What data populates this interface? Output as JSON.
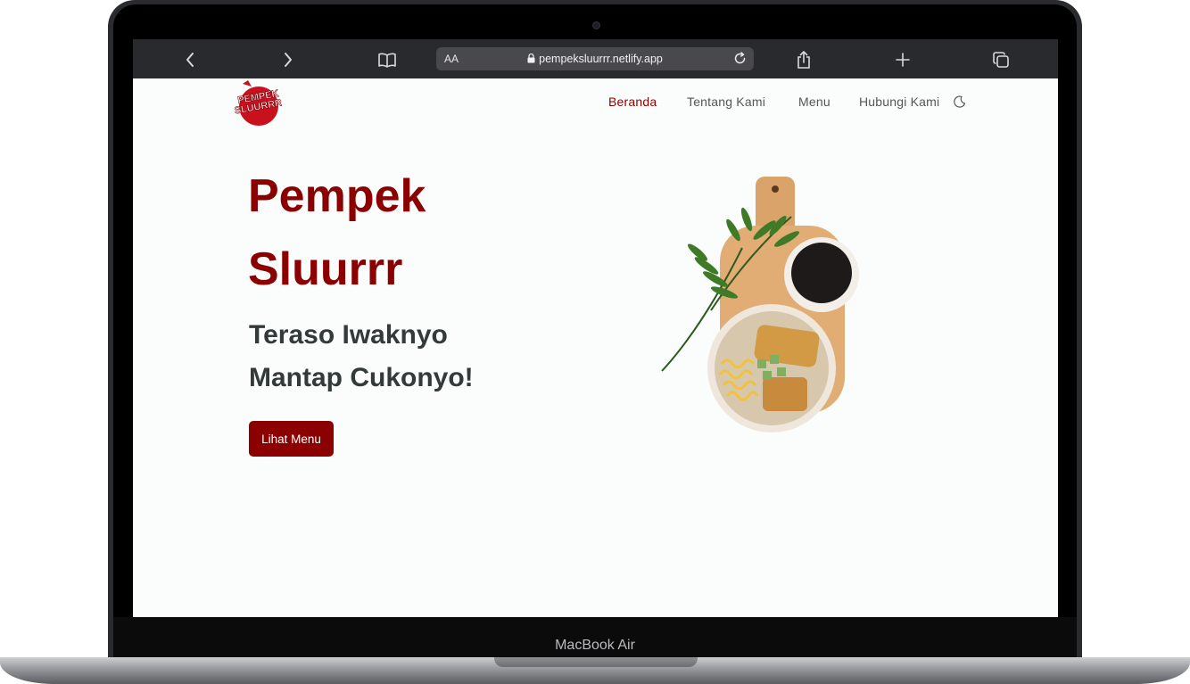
{
  "device": {
    "model_label": "MacBook Air"
  },
  "browser": {
    "back_icon": "chevron-left-icon",
    "forward_icon": "chevron-right-icon",
    "reader_icon": "book-icon",
    "text_size_label": "AA",
    "url": "pempeksluurrr.netlify.app",
    "share_icon": "share-icon",
    "new_tab_icon": "plus-icon",
    "tabs_icon": "tabs-icon"
  },
  "nav": {
    "logo_text_line1": "PEMPEK",
    "logo_text_line2": "SLUURRR",
    "items": [
      {
        "label": "Beranda",
        "active": true
      },
      {
        "label": "Tentang Kami",
        "active": false
      },
      {
        "label": "Menu",
        "active": false
      },
      {
        "label": "Hubungi Kami",
        "active": false
      }
    ],
    "theme_toggle_icon": "moon-icon"
  },
  "hero": {
    "title_line1": "Pempek",
    "title_line2": "Sluurrr",
    "subtitle_line1": "Teraso Iwaknyo",
    "subtitle_line2": "Mantap Cukonyo!",
    "button_label": "Lihat Menu",
    "image": "pempek-dish-image"
  },
  "colors": {
    "brand": "#8b0000",
    "page_background": "#fbfdfd",
    "heading_dark": "#333a3a",
    "toolbar": "#292a2e"
  }
}
